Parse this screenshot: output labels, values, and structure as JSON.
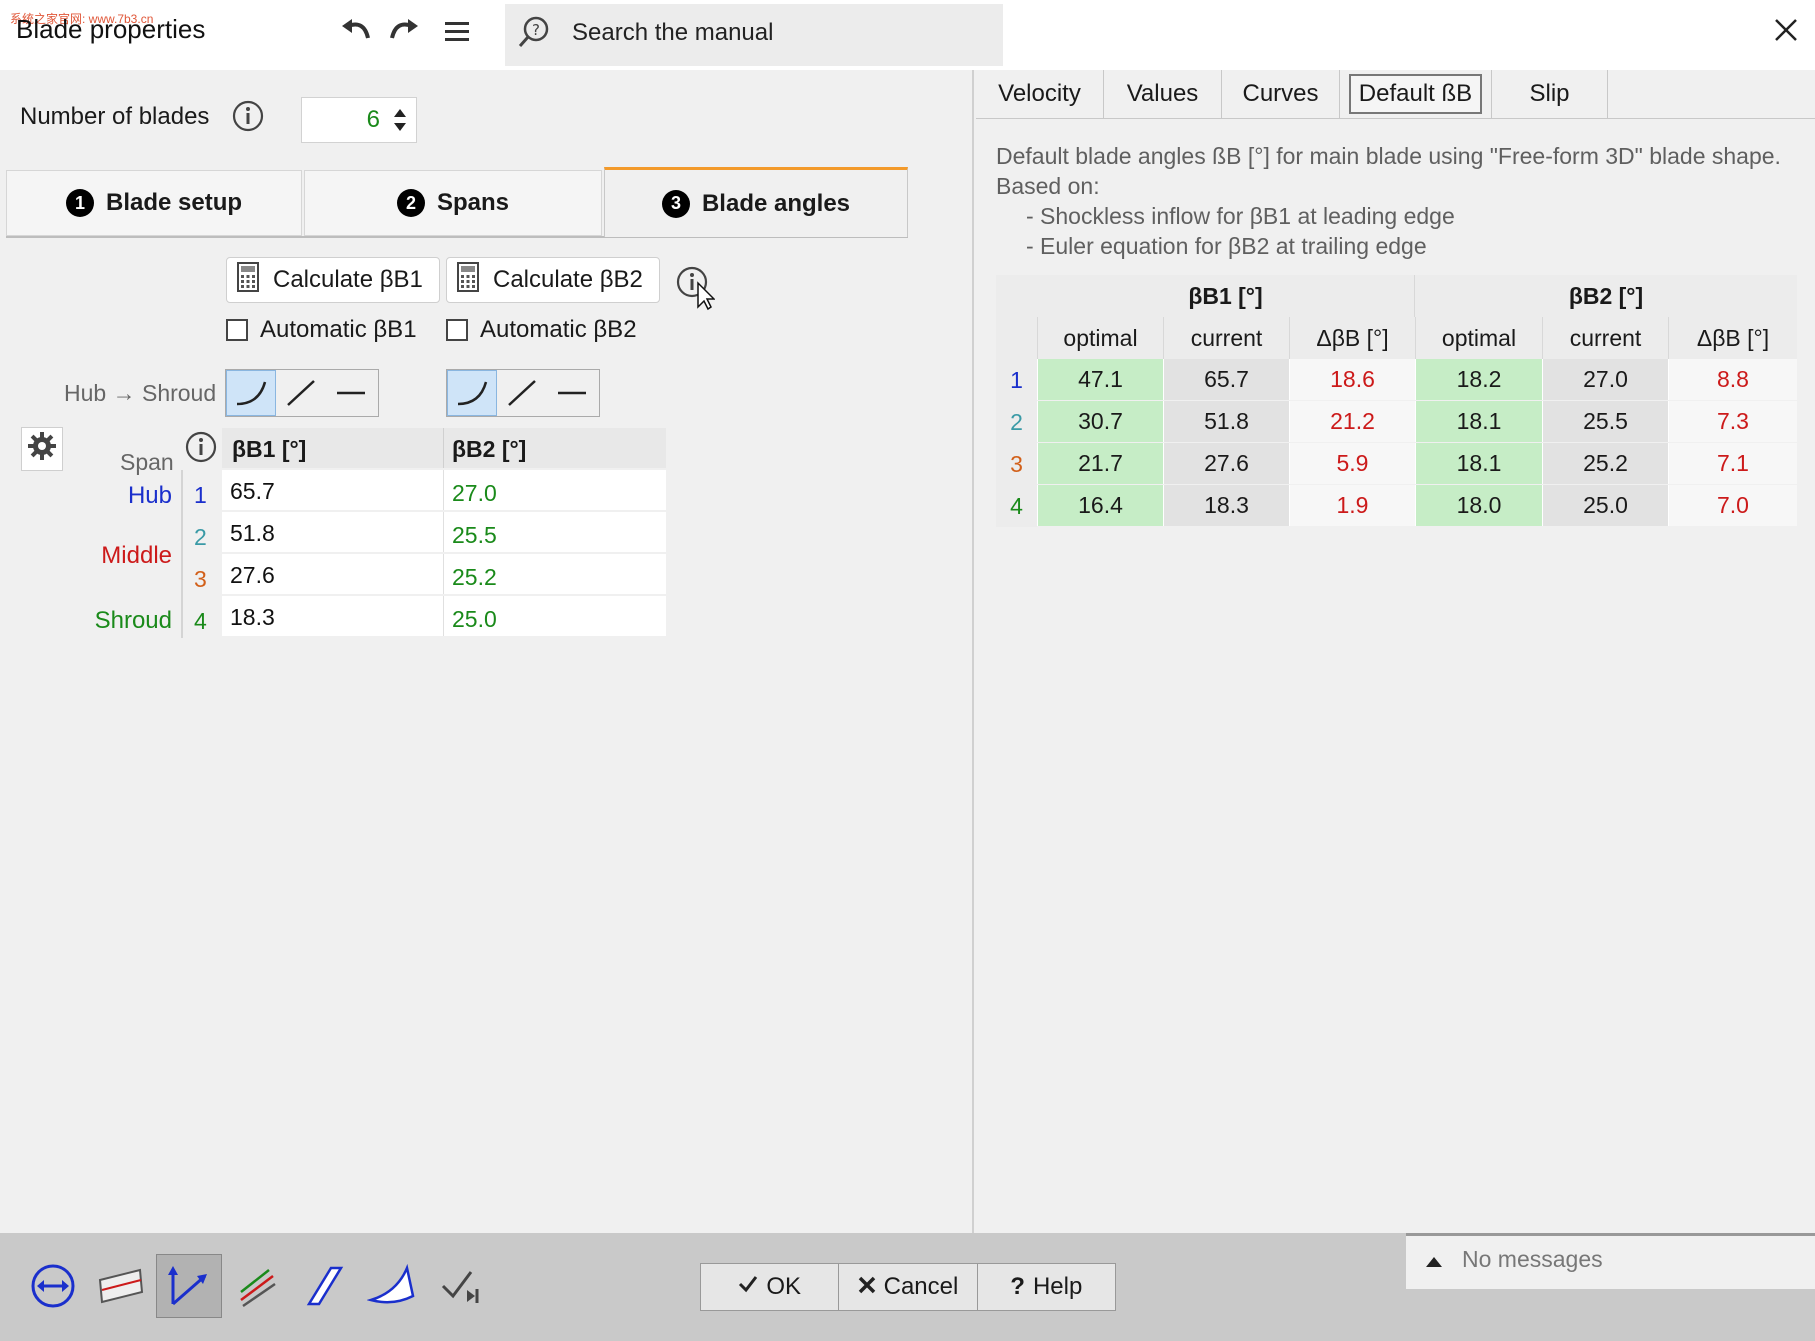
{
  "window": {
    "title": "Blade properties",
    "watermark": "系统之家官网: www.7b3.cn",
    "search_placeholder": "Search the manual"
  },
  "blades": {
    "label": "Number of blades",
    "value": "6"
  },
  "tabs": [
    {
      "num": "1",
      "label": "Blade setup"
    },
    {
      "num": "2",
      "label": "Spans"
    },
    {
      "num": "3",
      "label": "Blade angles"
    }
  ],
  "controls": {
    "calc_b1": "Calculate βB1",
    "calc_b2": "Calculate βB2",
    "auto_b1": "Automatic βB1",
    "auto_b2": "Automatic βB2",
    "hub_shroud": "Hub → Shroud"
  },
  "angle_table": {
    "span_header": "Span",
    "col_b1": "βB1 [°]",
    "col_b2": "βB2 [°]",
    "rows": [
      {
        "label": "Hub",
        "label_color": "#1a2fcc",
        "num": "1",
        "num_color": "#1a2fcc",
        "b1": "65.7",
        "b2": "27.0"
      },
      {
        "label": "",
        "label_color": "#cc1a1a",
        "num": "2",
        "num_color": "#3a9aa6",
        "b1": "51.8",
        "b2": "25.5"
      },
      {
        "label": "Middle",
        "label_color": "#cc1a1a",
        "num": "3",
        "num_color": "#d2601a",
        "b1": "27.6",
        "b2": "25.2"
      },
      {
        "label": "Shroud",
        "label_color": "#1a8a1a",
        "num": "4",
        "num_color": "#1a8a1a",
        "b1": "18.3",
        "b2": "25.0"
      }
    ]
  },
  "right_tabs": [
    "Velocity",
    "Values",
    "Curves",
    "Default ßB",
    "Slip"
  ],
  "description": {
    "line1": "Default blade angles ßB [°] for main blade using \"Free-form 3D\" blade shape.",
    "line2": "Based on:",
    "line3": "- Shockless inflow for βB1 at leading edge",
    "line4": "- Euler equation for βB2 at trailing edge"
  },
  "default_table": {
    "group_b1": "βB1 [°]",
    "group_b2": "βB2 [°]",
    "subheaders": [
      "optimal",
      "current",
      "ΔβB [°]",
      "optimal",
      "current",
      "ΔβB [°]"
    ],
    "rows": [
      {
        "num": "1",
        "num_color": "#1a2fcc",
        "vals": [
          "47.1",
          "65.7",
          "18.6",
          "18.2",
          "27.0",
          "8.8"
        ]
      },
      {
        "num": "2",
        "num_color": "#3a9aa6",
        "vals": [
          "30.7",
          "51.8",
          "21.2",
          "18.1",
          "25.5",
          "7.3"
        ]
      },
      {
        "num": "3",
        "num_color": "#d2601a",
        "vals": [
          "21.7",
          "27.6",
          "5.9",
          "18.1",
          "25.2",
          "7.1"
        ]
      },
      {
        "num": "4",
        "num_color": "#1a8a1a",
        "vals": [
          "16.4",
          "18.3",
          "1.9",
          "18.0",
          "25.0",
          "7.0"
        ]
      }
    ]
  },
  "footer": {
    "ok": "OK",
    "cancel": "Cancel",
    "help": "Help",
    "messages": "No messages"
  },
  "colors": {
    "accent_tab": "#f39a2b",
    "green_cell": "#c6edc6",
    "red_value": "#cc1a1a",
    "green_value": "#1a8a1a"
  }
}
